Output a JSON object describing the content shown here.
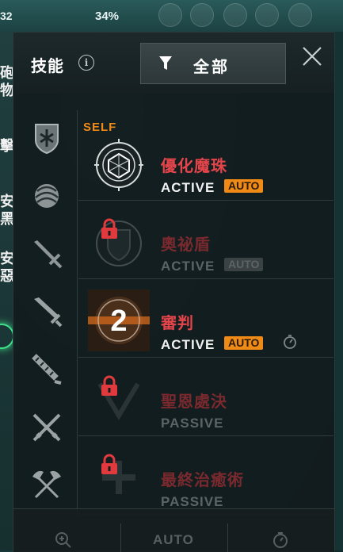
{
  "hud": {
    "level_fragment": "32",
    "percent": "34%",
    "left_fragments": [
      "砲",
      "物",
      "擊",
      "安",
      "黑",
      "安",
      "惡"
    ]
  },
  "panel": {
    "title": "技能",
    "info_icon": "info-icon",
    "filter": {
      "label": "全部",
      "icon": "funnel-icon"
    },
    "close_icon": "close-icon"
  },
  "categories": [
    {
      "name": "shield-emblem-icon"
    },
    {
      "name": "orb-icon"
    },
    {
      "name": "sword-icon"
    },
    {
      "name": "greatsword-icon"
    },
    {
      "name": "serrated-blade-icon"
    },
    {
      "name": "crossed-swords-icon"
    },
    {
      "name": "crossed-axes-icon"
    }
  ],
  "skills": [
    {
      "name": "優化魔珠",
      "type": "ACTIVE",
      "auto": "AUTO",
      "self_tag": "SELF",
      "locked": false,
      "icon": "magic-orb-icon"
    },
    {
      "name": "奧祕盾",
      "type": "ACTIVE",
      "auto": "AUTO",
      "locked": true,
      "icon": "arcane-shield-icon"
    },
    {
      "name": "審判",
      "type": "ACTIVE",
      "auto": "AUTO",
      "level": "2",
      "locked": false,
      "icon": "judgment-icon"
    },
    {
      "name": "聖恩處決",
      "type": "PASSIVE",
      "locked": true,
      "icon": "execution-icon"
    },
    {
      "name": "最終治癒術",
      "type": "PASSIVE",
      "locked": true,
      "icon": "final-heal-icon"
    }
  ],
  "bottom_bar": {
    "auto_label": "AUTO"
  },
  "colors": {
    "skill_name": "#e4454b",
    "auto_badge": "#ef8a17",
    "panel_bg": "#121c1e"
  }
}
